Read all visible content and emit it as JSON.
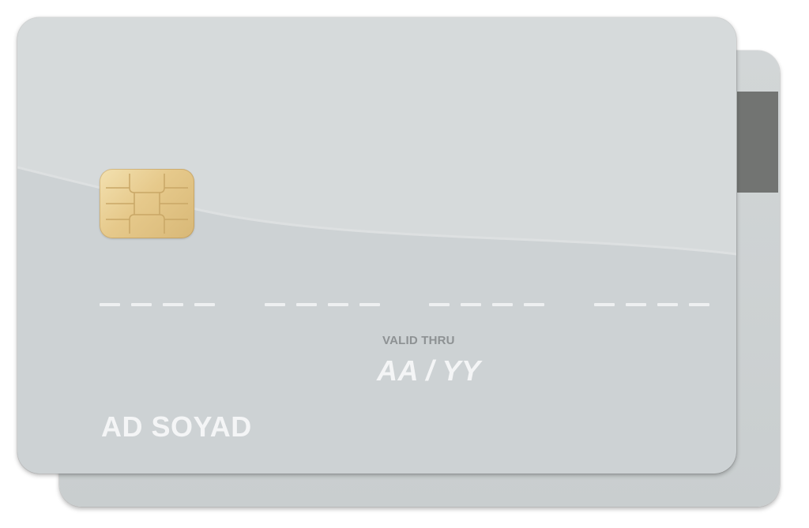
{
  "card": {
    "valid_thru_label": "VALID THRU",
    "expiry_placeholder": "AA / YY",
    "holder_placeholder": "AD SOYAD",
    "number_groups": 4,
    "dashes_per_group": 4
  },
  "colors": {
    "card_body": "#cdd2d4",
    "magstripe": "#727472",
    "chip_gold": "#e6c98b",
    "text_light": "#f4f5f6",
    "label_gray": "#8d9193"
  },
  "icons": {
    "chip": "emv-chip-icon",
    "magstripe": "magnetic-stripe"
  }
}
